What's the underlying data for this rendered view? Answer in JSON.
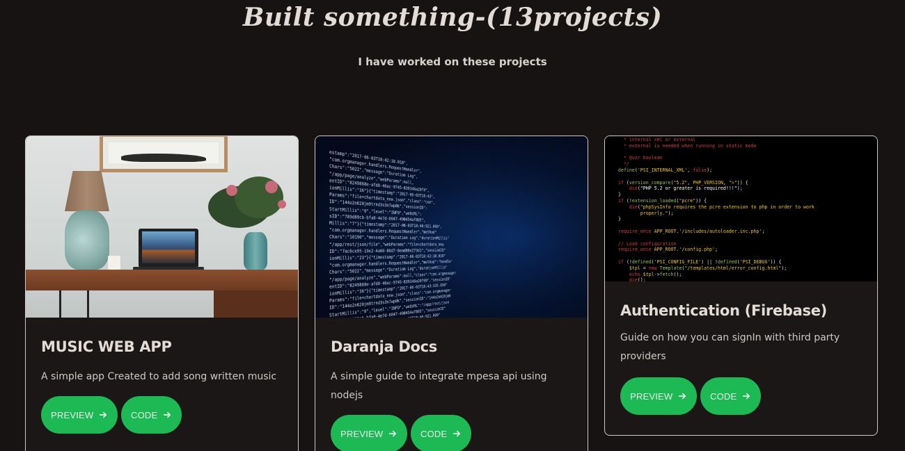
{
  "header": {
    "title": "Built something-(13projects)",
    "subtitle": "I have worked on these projects"
  },
  "projects": [
    {
      "title": "MUSIC WEB APP",
      "description": "A simple app Created to add song written music",
      "preview_label": "PREVIEW",
      "code_label": "CODE",
      "image": "desk-laptop-lamp-photo"
    },
    {
      "title": "Daranja Docs",
      "description": "A simple guide to integrate mpesa api using nodejs",
      "preview_label": "PREVIEW",
      "code_label": "CODE",
      "image": "code-stream-photo"
    },
    {
      "title": "Authentication (Firebase)",
      "description": "Guide on how you can signIn with third party providers",
      "preview_label": "PREVIEW",
      "code_label": "CODE",
      "image": "php-code-editor-screenshot"
    }
  ],
  "colors": {
    "background": "#171312",
    "button": "#1db954",
    "card_border": "#cfc9c4"
  },
  "icons": {
    "button_arrow": "arrow-right-icon"
  }
}
